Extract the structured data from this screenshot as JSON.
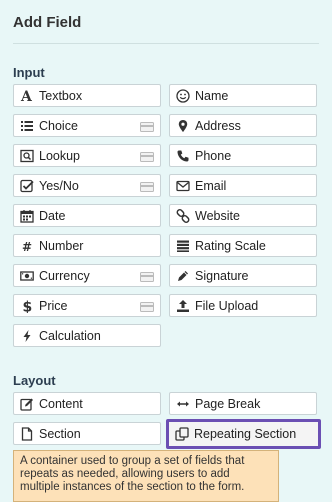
{
  "panel": {
    "title": "Add Field"
  },
  "sections": {
    "input": "Input",
    "layout": "Layout"
  },
  "input_fields": [
    {
      "label": "Textbox",
      "icon": "letter-a-icon"
    },
    {
      "label": "Name",
      "icon": "smiley-icon"
    },
    {
      "label": "Choice",
      "icon": "list-icon"
    },
    {
      "label": "Address",
      "icon": "map-pin-icon"
    },
    {
      "label": "Lookup",
      "icon": "lookup-icon"
    },
    {
      "label": "Phone",
      "icon": "phone-icon"
    },
    {
      "label": "Yes/No",
      "icon": "checkbox-icon"
    },
    {
      "label": "Email",
      "icon": "envelope-icon"
    },
    {
      "label": "Date",
      "icon": "calendar-icon"
    },
    {
      "label": "Website",
      "icon": "link-icon"
    },
    {
      "label": "Number",
      "icon": "hash-icon"
    },
    {
      "label": "Rating Scale",
      "icon": "rating-scale-icon"
    },
    {
      "label": "Currency",
      "icon": "money-icon"
    },
    {
      "label": "Signature",
      "icon": "pen-icon"
    },
    {
      "label": "Price",
      "icon": "dollar-icon"
    },
    {
      "label": "File Upload",
      "icon": "upload-icon"
    },
    {
      "label": "Calculation",
      "icon": "lightning-icon"
    }
  ],
  "layout_fields": [
    {
      "label": "Content",
      "icon": "edit-icon"
    },
    {
      "label": "Page Break",
      "icon": "horizontal-arrows-icon"
    },
    {
      "label": "Section",
      "icon": "document-icon"
    },
    {
      "label": "Repeating Section",
      "icon": "copy-icon"
    }
  ],
  "tooltip": {
    "text": "A container used to group a set of fields that repeats as needed, allowing users to add multiple instances of the section to the form."
  }
}
